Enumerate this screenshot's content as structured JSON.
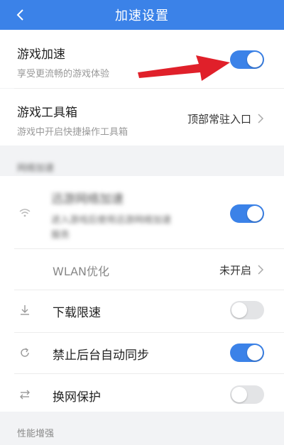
{
  "header": {
    "title": "加速设置"
  },
  "game_accel": {
    "title": "游戏加速",
    "subtitle": "享受更流畅的游戏体验",
    "enabled": true
  },
  "toolbox": {
    "title": "游戏工具箱",
    "subtitle": "游戏中开启快捷操作工具箱",
    "value": "顶部常驻入口"
  },
  "network_section": {
    "label": "网络加速",
    "xunyou": {
      "title": "迅游网络加速",
      "subtitle_1": "进入游戏后使用迅游网络加速",
      "subtitle_2": "服务",
      "enabled": true
    },
    "wlan": {
      "label": "WLAN优化",
      "value": "未开启"
    },
    "download_limit": {
      "label": "下载限速",
      "enabled": false
    },
    "bg_sync": {
      "label": "禁止后台自动同步",
      "enabled": true
    },
    "net_switch": {
      "label": "换网保护",
      "enabled": false
    }
  },
  "performance_section": {
    "label": "性能增强"
  },
  "colors": {
    "accent": "#3b82e8",
    "arrow": "#e0202a"
  }
}
